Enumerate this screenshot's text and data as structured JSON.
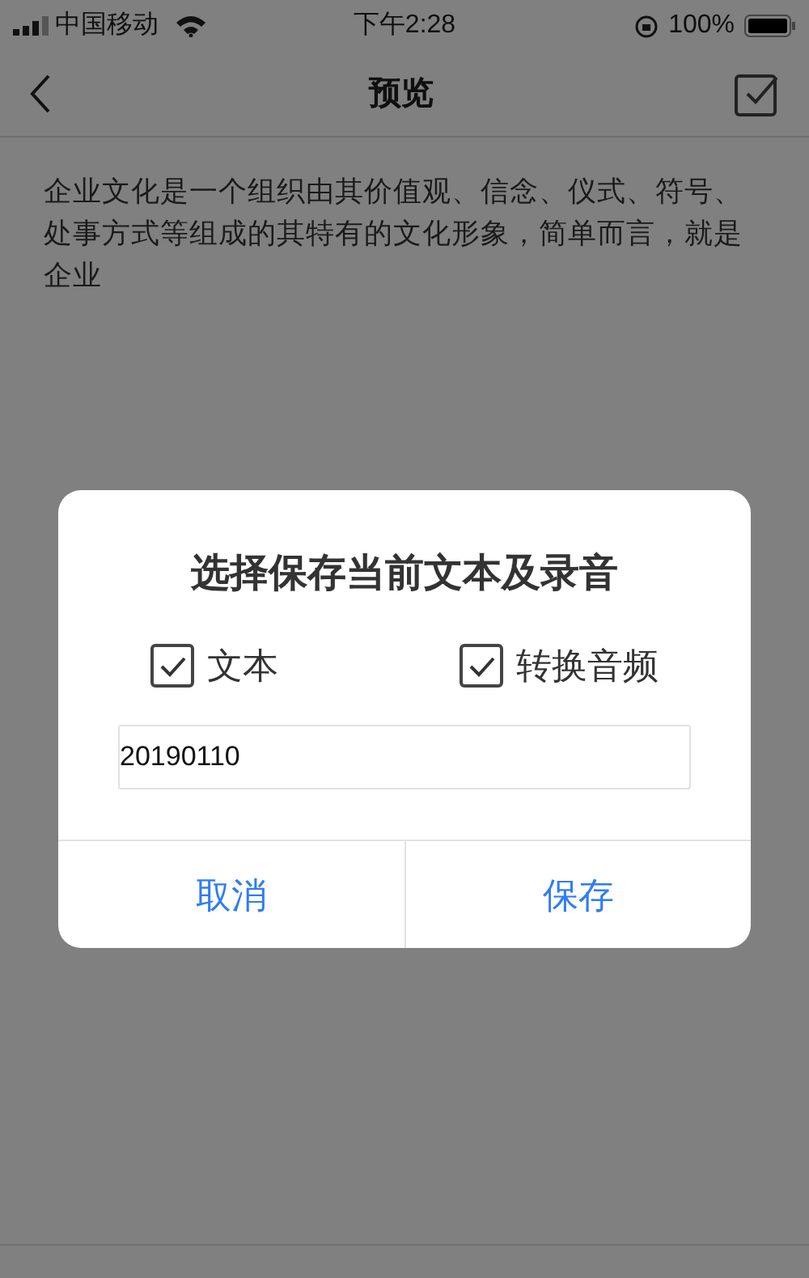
{
  "status_bar": {
    "carrier": "中国移动",
    "time": "下午2:28",
    "battery": "100%"
  },
  "nav": {
    "title": "预览"
  },
  "body": {
    "text": "企业文化是一个组织由其价值观、信念、仪式、符号、处事方式等组成的其特有的文化形象，简单而言，就是企业"
  },
  "dialog": {
    "title": "选择保存当前文本及录音",
    "options": [
      {
        "label": "文本",
        "checked": true
      },
      {
        "label": "转换音频",
        "checked": true
      }
    ],
    "filename": {
      "value": "20190110"
    },
    "buttons": [
      "取消",
      "保存"
    ]
  }
}
